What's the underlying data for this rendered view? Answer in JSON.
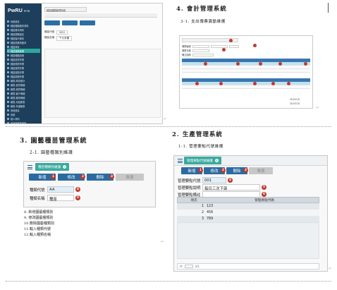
{
  "app1": {
    "logo": "PwRU",
    "logo_sub": "RTE",
    "tab": "種苗種類管理系統",
    "fields": [
      {
        "label": "種苗代號",
        "value": "0010"
      },
      {
        "label": "種苗名稱",
        "value": "千元未種"
      }
    ],
    "sidebar": [
      "系統設定",
      "種苗種類基本資料",
      "種苗基本資料",
      "種苗價格設定",
      "種苗客戶基本",
      "種苗供應商基本",
      "種苗庫存",
      "種苗種類管理",
      "種苗種類查詢",
      "種苗進貨作業",
      "種苗銷貨作業",
      "種苗退貨作業",
      "種苗盤點作業",
      "種苗調撥作業",
      "報表-庫存統計",
      "報表-進貨明細",
      "報表-銷貨明細",
      "報表-客戶明細",
      "報表-廠商明細",
      "報表-月結帳表",
      "報表-年度報表",
      "其他設定",
      "系統",
      "個人資料",
      "系統管理員維護"
    ],
    "active_index": 7
  },
  "accounting": {
    "heading": "4. 會計管理系統",
    "subheading": "3-1. 支出傳票異動維護",
    "row_labels": [
      "傳票編號",
      "傳票日期",
      "備註說明"
    ],
    "totals": [
      "35,000.00",
      "35,000.00"
    ]
  },
  "horticulture": {
    "heading": "3. 園藝種苗管理系統",
    "subheading": "2-1. 園藝種類別維護",
    "tab": "種苗種類別維護",
    "buttons": [
      {
        "label": "新增",
        "badge": "1"
      },
      {
        "label": "修改",
        "badge": "2"
      },
      {
        "label": "刪除",
        "badge": "3"
      },
      {
        "label": "單選",
        "badge": ""
      }
    ],
    "fields": [
      {
        "label": "種類代號",
        "value": "AA",
        "badge": "4"
      },
      {
        "label": "種類名稱",
        "value": "種苗",
        "badge": "5"
      }
    ],
    "list": [
      "8. 新增園藝種類別",
      "9. 修改園藝種類別",
      "10.刪除園藝種類別",
      "11.輸入種類代號",
      "12.輸入種類名稱"
    ]
  },
  "production": {
    "heading": "2. 生產管理系統",
    "subheading": "1-1. 管理要點代號維護",
    "tab": "管理要點代號維護",
    "buttons": [
      {
        "label": "新增",
        "badge": "1"
      },
      {
        "label": "修改",
        "badge": "2"
      },
      {
        "label": "刪除",
        "badge": "3"
      },
      {
        "label": "單選",
        "badge": ""
      }
    ],
    "fields": [
      {
        "label": "管理要點代號",
        "value": "001",
        "badge": "4"
      },
      {
        "label": "管理要點說明",
        "value": "每日三次下架",
        "badge": "5"
      },
      {
        "label": "管理要點備註",
        "value": "",
        "badge": "6"
      }
    ],
    "columns": [
      "項次",
      "管理要點代碼"
    ],
    "rows": [
      {
        "no": "1",
        "code": "123"
      },
      {
        "no": "2",
        "code": "456"
      },
      {
        "no": "3",
        "code": "789"
      }
    ],
    "pager": "1/1"
  },
  "colors": {
    "primary": "#2b6aa0",
    "teal": "#3aaa9e",
    "badge": "#c0392b",
    "sidebar": "#1d3f5c"
  }
}
